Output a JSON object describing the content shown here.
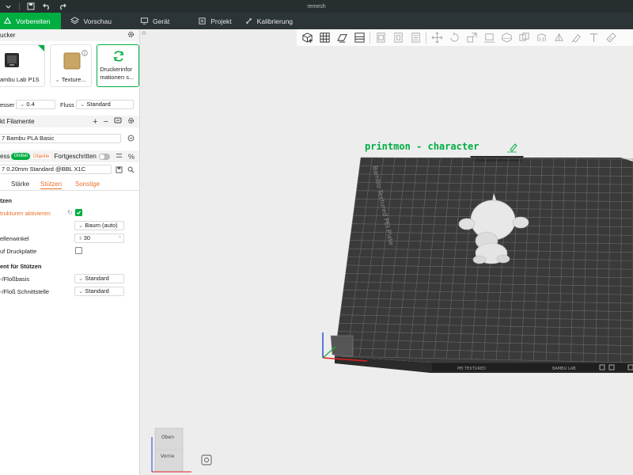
{
  "window": {
    "title": "remesh"
  },
  "tabs": [
    {
      "label": "Vorbereiten",
      "icon": "prepare-icon",
      "active": true
    },
    {
      "label": "Vorschau",
      "icon": "layers-icon",
      "active": false
    },
    {
      "label": "Gerät",
      "icon": "device-icon",
      "active": false
    },
    {
      "label": "Projekt",
      "icon": "project-icon",
      "active": false
    },
    {
      "label": "Kalibrierung",
      "icon": "calibration-icon",
      "active": false
    }
  ],
  "printer_section": {
    "title": "ucker",
    "printer_card_label": "ambu Lab P1S",
    "plate_card_label": "Texture...",
    "sync_card_label_1": "Druckerinfor",
    "sync_card_label_2": "mationen s..."
  },
  "nozzle": {
    "label": "esser",
    "value": "0.4",
    "flow_label": "Fluss",
    "flow_value": "Standard"
  },
  "filament_section": {
    "title": "kt Filamente",
    "filament_name": "Bambu PLA Basic",
    "filament_prefix": "7"
  },
  "process": {
    "label": "ess",
    "global_pill": "Global",
    "objects_pill": "Objekte",
    "advanced_label": "Fortgeschritten",
    "profile_prefix": "7",
    "profile_value": "0.20mm Standard @BBL X1C"
  },
  "subtabs": [
    {
      "label": "Stärke",
      "active": false
    },
    {
      "label": "Stützen",
      "active": true
    },
    {
      "label": "Sonstige",
      "active": false
    }
  ],
  "support": {
    "group1_title": "tzen",
    "enable_label": "trukturen aktivieren",
    "enable_checked": true,
    "type_value": "Baum (auto)",
    "angle_label": "ellenwinkel",
    "angle_value": "30",
    "on_plate_label": "uf Druckplatte",
    "on_plate_checked": false,
    "group2_title": "ent für Stützen",
    "base_label": "-/Floßbasis",
    "base_value": "Standard",
    "interface_label": "-/Floß Schnittstelle",
    "interface_value": "Standard"
  },
  "toolbar_icons": [
    "add-object-icon",
    "arrange-grid-icon",
    "orient-icon",
    "plate-layout-icon",
    "split-objects-icon",
    "split-parts-icon",
    "variable-layer-icon",
    "move-icon",
    "rotate-icon",
    "scale-icon",
    "lay-on-face-icon",
    "cut-icon",
    "mesh-boolean-icon",
    "support-paint-icon",
    "seam-paint-icon",
    "color-paint-icon",
    "text-tool-icon",
    "measure-icon"
  ],
  "plate": {
    "name_label": "printmon - character",
    "bed_text": "Bambu Textured PEI Plate",
    "logo_text": "BAMBU LAB",
    "front_label": "PEI TEXTURED"
  },
  "view_cube": {
    "top_label": "Oben",
    "front_label": "Vorne"
  },
  "colors": {
    "accent": "#00ae42",
    "titlebar": "#262e30",
    "tabbar": "#2b3436",
    "bed": "#3a3a3a",
    "bed_grid": "#666666",
    "label_green": "#00ae42",
    "orange_text": "#e8702a"
  }
}
